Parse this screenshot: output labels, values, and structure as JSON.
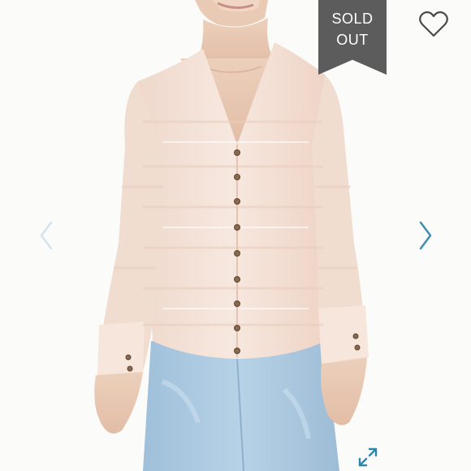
{
  "listing": {
    "status_line1": "SOLD",
    "status_line2": "OUT"
  },
  "icons": {
    "like": "heart-outline-icon",
    "previous": "chevron-left-icon",
    "next": "chevron-right-icon",
    "expand": "expand-diagonal-icon"
  },
  "colors": {
    "banner": "#5c5c5c",
    "arrow_inactive": "#d4e4ec",
    "arrow_active": "#3f8fb0",
    "expand": "#2e86ab",
    "blouse": "#f3ddd2",
    "jeans": "#a9c8df"
  }
}
